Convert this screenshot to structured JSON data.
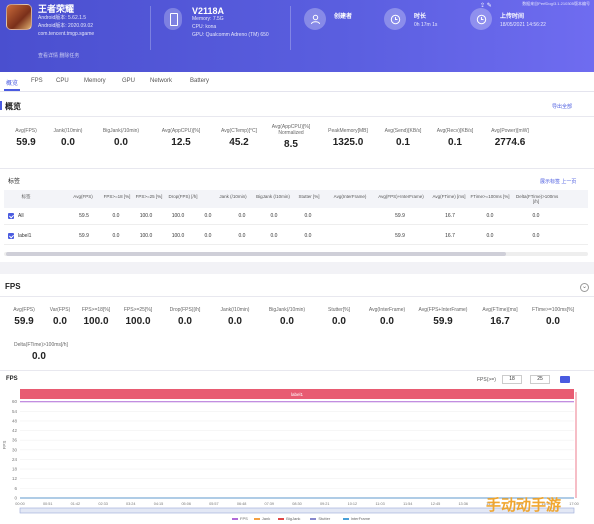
{
  "header": {
    "app": {
      "name": "王者荣耀",
      "lines": [
        "Android版本: 5.62.1.5",
        "Android版本: 2020.09.02",
        "com.tencent.tmgp.sgame"
      ],
      "link": "查看详情 删除任务"
    },
    "device": {
      "name": "V2118A",
      "lines": [
        "Memory: 7.5G",
        "CPU: kona",
        "GPU: Qualcomm Adreno (TM) 650"
      ]
    },
    "stats": [
      {
        "label": "创建者",
        "value": ""
      },
      {
        "label": "时长",
        "value": "0h 17m 1s"
      },
      {
        "label": "上传时间",
        "value": "18/05/2021 14:56:22"
      }
    ],
    "top_right": "数据来自PerfDog/3.1.210305版本编号"
  },
  "tabs": [
    "概览",
    "FPS",
    "CPU",
    "Memory",
    "GPU",
    "Network",
    "Battery"
  ],
  "overview": {
    "title": "概览",
    "link": "导出全部",
    "metrics": [
      {
        "label": "Avg(FPS)",
        "value": "59.9"
      },
      {
        "label": "Jank(/10min)",
        "value": "0.0"
      },
      {
        "label": "BigJank(/10min)",
        "value": "0.0"
      },
      {
        "label": "Avg(AppCPU)[%]",
        "value": "12.5"
      },
      {
        "label": "Avg(CTemp)[°C]",
        "value": "45.2"
      },
      {
        "label": "Avg(AppCPU)[%] Normalized",
        "value": "8.5"
      },
      {
        "label": "PeakMemory[MB]",
        "value": "1325.0"
      },
      {
        "label": "Avg(Send)[KB/s]",
        "value": "0.1"
      },
      {
        "label": "Avg(Recv)[KB/s]",
        "value": "0.1"
      },
      {
        "label": "Avg(Power)[mW]",
        "value": "2774.6"
      }
    ]
  },
  "labels": {
    "title": "标签",
    "links": "展示标签 上一页",
    "columns": [
      "标签",
      "Avg(FPS)",
      "FPS>=18 [%]",
      "FPS>=25 [%]",
      "Drop(FPS) [/h]",
      "Jank (/10min)",
      "BigJank (/10min)",
      "Stutter [%]",
      "Avg(InterFrame)",
      "Avg(FPS)+InterFrame)",
      "Avg(FTime) [ms]",
      "FTime>=100ms [%]",
      "Delta(FTime)>100ms [/h]"
    ],
    "rows": [
      {
        "name": "All",
        "cells": [
          "59.5",
          "0.0",
          "100.0",
          "100.0",
          "0.0",
          "0.0",
          "0.0",
          "0.0",
          "",
          "59.9",
          "16.7",
          "0.0",
          "0.0"
        ]
      },
      {
        "name": "label1",
        "cells": [
          "59.9",
          "0.0",
          "100.0",
          "100.0",
          "0.0",
          "0.0",
          "0.0",
          "0.0",
          "",
          "59.9",
          "16.7",
          "0.0",
          "0.0"
        ]
      }
    ]
  },
  "fps_section": {
    "title": "FPS",
    "metrics": [
      {
        "label": "Avg(FPS)",
        "value": "59.9"
      },
      {
        "label": "Var(FPS)",
        "value": "0.0"
      },
      {
        "label": "FPS>=18[%]",
        "value": "100.0"
      },
      {
        "label": "FPS>=25[%]",
        "value": "100.0"
      },
      {
        "label": "Drop(FPS)[/h]",
        "value": "0.0"
      },
      {
        "label": "Jank(/10min)",
        "value": "0.0"
      },
      {
        "label": "BigJank(/10min)",
        "value": "0.0"
      },
      {
        "label": "Stutter[%]",
        "value": "0.0"
      },
      {
        "label": "Avg(InterFrame)",
        "value": "0.0"
      },
      {
        "label": "Avg(FPS+InterFrame)",
        "value": "59.9"
      },
      {
        "label": "Avg(FTime)[ms]",
        "value": "16.7"
      },
      {
        "label": "FTime>=100ms[%]",
        "value": "0.0"
      },
      {
        "label": "Delta(FTime)>100ms[/h]",
        "value": "0.0"
      }
    ]
  },
  "chart_controls": {
    "label": "FPS(>=)",
    "input1": "18",
    "input2": "25"
  },
  "chart_data": {
    "type": "line",
    "title": "FPS",
    "band_label": "label1",
    "y_ticks": [
      "0",
      "6",
      "12",
      "18",
      "24",
      "30",
      "36",
      "42",
      "48",
      "54",
      "60"
    ],
    "ylim": [
      0,
      66
    ],
    "x_ticks": [
      "00:00",
      "00:51",
      "01:42",
      "02:33",
      "03:24",
      "04:15",
      "05:06",
      "05:57",
      "06:48",
      "07:39",
      "08:30",
      "09:21",
      "10:12",
      "11:03",
      "11:54",
      "12:45",
      "13:36",
      "14:27",
      "15:18",
      "16:09",
      "17:00"
    ],
    "ylabel": "FPS",
    "series": [
      {
        "name": "FPS",
        "color": "#b06ad8",
        "value": 59.9
      },
      {
        "name": "Jank",
        "color": "#f5a142",
        "value": 0
      },
      {
        "name": "BigJank",
        "color": "#e04848",
        "value": 0
      },
      {
        "name": "Stutter",
        "color": "#8888cc",
        "value": 0
      },
      {
        "name": "InterFrame",
        "color": "#4aa0d8",
        "value": 0
      }
    ]
  },
  "watermark": "手动动手游"
}
